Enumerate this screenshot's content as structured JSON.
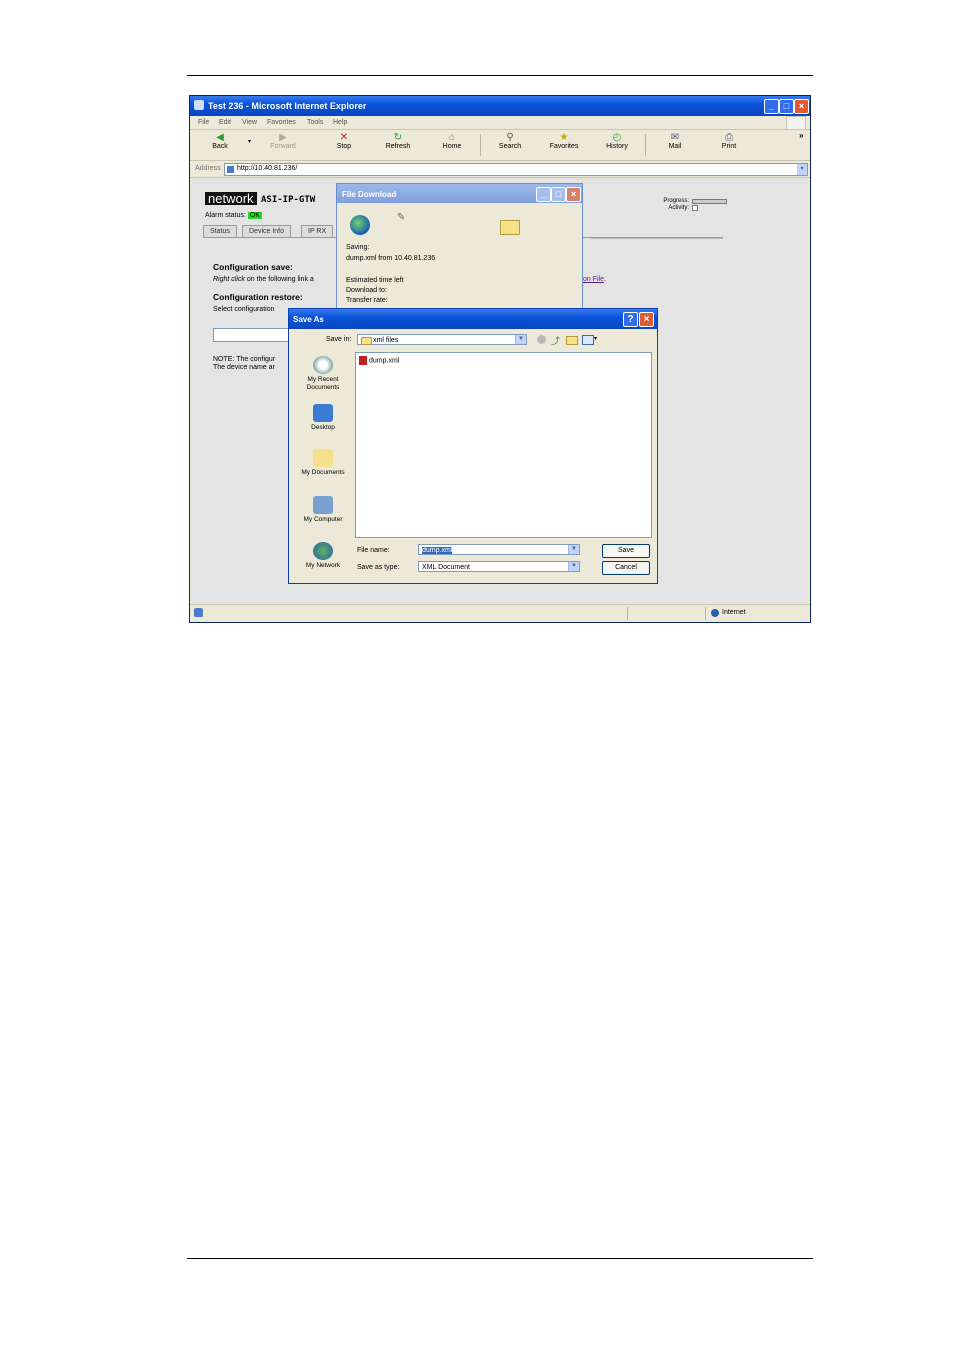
{
  "browser": {
    "title": "Test 236 - Microsoft Internet Explorer",
    "menu": [
      "File",
      "Edit",
      "View",
      "Favorites",
      "Tools",
      "Help"
    ],
    "toolbar": {
      "back": "Back",
      "forward": "Forward",
      "stop": "Stop",
      "refresh": "Refresh",
      "home": "Home",
      "search": "Search",
      "favorites": "Favorites",
      "history": "History",
      "mail": "Mail",
      "print": "Print",
      "more": "»"
    },
    "address_label": "Address",
    "address_value": "http://10.40.81.236/",
    "status_zone": "Internet"
  },
  "page": {
    "logo": "network",
    "device": "ASI-IP-GTW",
    "alarm_label": "Alarm status:",
    "alarm_value": "OK",
    "tabs": [
      "Status",
      "Device Info",
      "IP RX"
    ],
    "progress_label": "Progress:",
    "activity_label": "Activity:",
    "config_save_heading": "Configuration save:",
    "config_save_text_em": "Right click",
    "config_save_text": "on the following link a",
    "config_link_tail": "on File",
    "config_restore_heading": "Configuration restore:",
    "config_restore_text": "Select configuration",
    "note_line1": "NOTE: The configur",
    "note_line2": "The device name ar"
  },
  "file_download": {
    "title": "File Download",
    "saving_label": "Saving:",
    "saving_value": "dump.xml from 10.40.81.236",
    "estimated_label": "Estimated time left",
    "download_to_label": "Download to:",
    "transfer_rate_label": "Transfer rate:"
  },
  "save_as": {
    "title": "Save As",
    "help": "?",
    "save_in_label": "Save in:",
    "save_in_value": "xml files",
    "places": [
      "My Recent Documents",
      "Desktop",
      "My Documents",
      "My Computer",
      "My Network"
    ],
    "files": [
      "dump.xml"
    ],
    "file_name_label": "File name:",
    "file_name_value": "dump.xml",
    "save_as_type_label": "Save as type:",
    "save_as_type_value": "XML Document",
    "save_button": "Save",
    "cancel_button": "Cancel"
  },
  "colors": {
    "title_bar": "#0a54d8",
    "alarm_ok": "#22dd22",
    "window_bg": "#ece9d8"
  }
}
